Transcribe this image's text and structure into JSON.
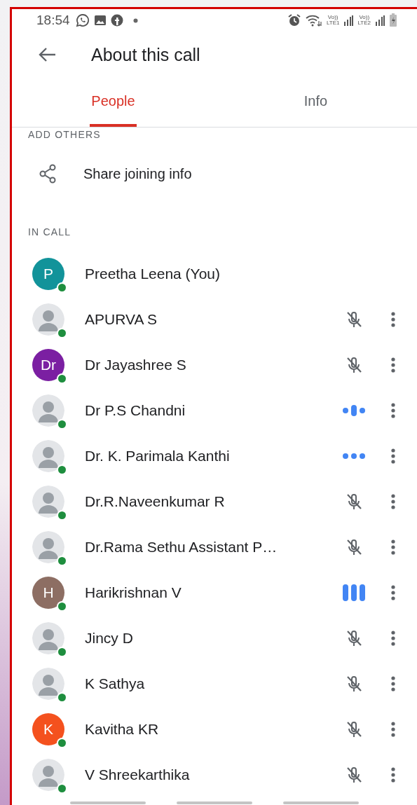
{
  "status_bar": {
    "time": "18:54",
    "sim_labels": [
      {
        "top": "Vo))",
        "bottom": "LTE1"
      },
      {
        "top": "Vo))",
        "bottom": "LTE2"
      }
    ]
  },
  "header": {
    "title": "About this call"
  },
  "tabs": [
    {
      "label": "People",
      "selected": true
    },
    {
      "label": "Info",
      "selected": false
    }
  ],
  "add_others": {
    "heading": "ADD OTHERS",
    "share_label": "Share joining info"
  },
  "in_call": {
    "heading": "IN CALL",
    "participants": [
      {
        "name": "Preetha Leena (You)",
        "avatar": {
          "kind": "letter",
          "letter": "P",
          "color": "#12939a"
        },
        "menu": false
      },
      {
        "name": "APURVA S",
        "avatar": {
          "kind": "photo"
        },
        "audio": {
          "kind": "muted"
        },
        "menu": true
      },
      {
        "name": "Dr Jayashree S",
        "avatar": {
          "kind": "letter",
          "letter": "Dr",
          "color": "#7b1fa2"
        },
        "audio": {
          "kind": "muted"
        },
        "menu": true
      },
      {
        "name": "Dr P.S Chandni",
        "avatar": {
          "kind": "photo"
        },
        "audio": {
          "kind": "pulse"
        },
        "menu": true
      },
      {
        "name": "Dr. K. Parimala Kanthi",
        "avatar": {
          "kind": "photo"
        },
        "audio": {
          "kind": "dots"
        },
        "menu": true
      },
      {
        "name": "Dr.R.Naveenkumar R",
        "avatar": {
          "kind": "photo"
        },
        "audio": {
          "kind": "muted"
        },
        "menu": true
      },
      {
        "name": "Dr.Rama Sethu Assistant P…",
        "avatar": {
          "kind": "photo"
        },
        "audio": {
          "kind": "muted"
        },
        "menu": true
      },
      {
        "name": "Harikrishnan V",
        "avatar": {
          "kind": "letter",
          "letter": "H",
          "color": "#8d6e63"
        },
        "audio": {
          "kind": "bars"
        },
        "menu": true
      },
      {
        "name": "Jincy D",
        "avatar": {
          "kind": "photo"
        },
        "audio": {
          "kind": "muted"
        },
        "menu": true
      },
      {
        "name": "K Sathya",
        "avatar": {
          "kind": "photo"
        },
        "audio": {
          "kind": "muted"
        },
        "menu": true
      },
      {
        "name": "Kavitha KR",
        "avatar": {
          "kind": "letter",
          "letter": "K",
          "color": "#f4511e"
        },
        "audio": {
          "kind": "muted"
        },
        "menu": true
      },
      {
        "name": "V Shreekarthika",
        "avatar": {
          "kind": "photo"
        },
        "audio": {
          "kind": "muted"
        },
        "menu": true
      }
    ]
  }
}
